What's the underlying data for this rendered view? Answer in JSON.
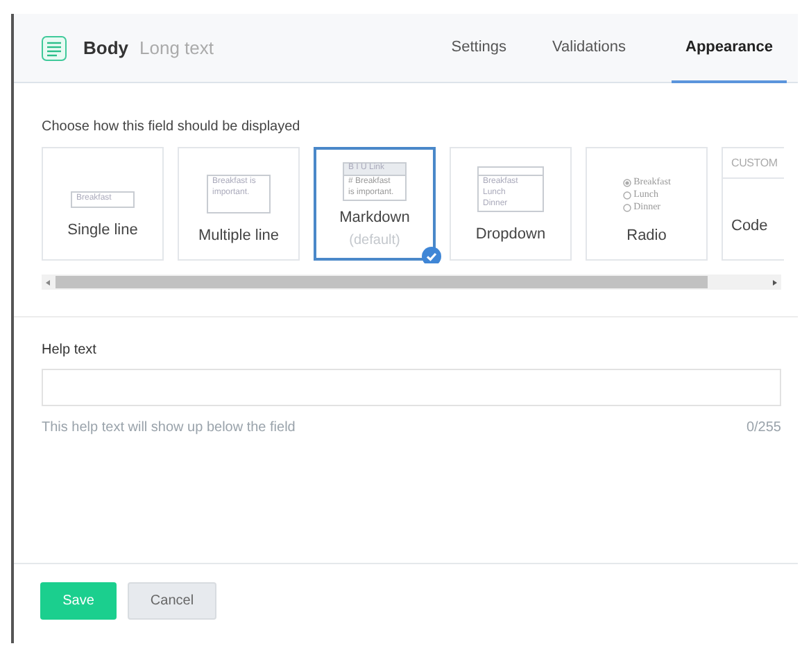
{
  "header": {
    "title": "Body",
    "subtitle": "Long text"
  },
  "tabs": [
    {
      "label": "Settings",
      "selected": false
    },
    {
      "label": "Validations",
      "selected": false
    },
    {
      "label": "Appearance",
      "selected": true
    }
  ],
  "appearance": {
    "prompt": "Choose how this field should be displayed",
    "options": [
      {
        "kind": "single",
        "label": "Single line",
        "preview": [
          "Breakfast"
        ],
        "selected": false
      },
      {
        "kind": "multi",
        "label": "Multiple line",
        "preview": [
          "Breakfast is",
          "important."
        ],
        "selected": false
      },
      {
        "kind": "markdown",
        "label": "Markdown",
        "sublabel": "(default)",
        "toolbar": [
          "B",
          "I",
          "U",
          "Link"
        ],
        "preview": [
          "# Breakfast",
          "is important."
        ],
        "selected": true
      },
      {
        "kind": "dropdown",
        "label": "Dropdown",
        "preview": [
          "Breakfast",
          "Lunch",
          "Dinner"
        ],
        "selected": false
      },
      {
        "kind": "radio",
        "label": "Radio",
        "choices": [
          {
            "text": "Breakfast",
            "selected": true
          },
          {
            "text": "Lunch",
            "selected": false
          },
          {
            "text": "Dinner",
            "selected": false
          }
        ],
        "selected": false
      },
      {
        "kind": "custom",
        "heading": "CUSTOM",
        "label": "Code",
        "selected": false
      }
    ]
  },
  "help": {
    "label": "Help text",
    "hint": "This help text will show up below the field",
    "counter": "0/255"
  },
  "buttons": [
    {
      "kind": "primary",
      "label": "Save"
    },
    {
      "kind": "secondary",
      "label": "Cancel"
    }
  ]
}
